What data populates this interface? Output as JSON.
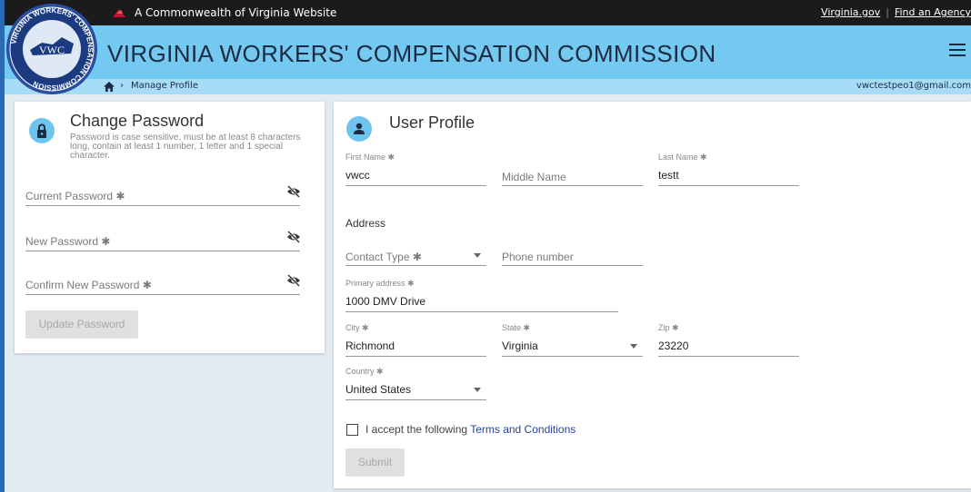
{
  "header": {
    "commonwealth_text": "A Commonwealth of Virginia Website",
    "links": [
      "Virginia.gov",
      "Find an Agency"
    ],
    "title": "VIRGINIA WORKERS' COMPENSATION COMMISSION",
    "logo_ring_text": "VIRGINIA WORKERS' COMPENSATION COMMISSION",
    "logo_center": "VWC"
  },
  "breadcrumb": {
    "current": "Manage Profile",
    "user_email": "vwctestpeo1@gmail.com"
  },
  "change_password": {
    "title": "Change Password",
    "help": "Password is case sensitive, must be at least 8 characters long, contain at least 1 number, 1 letter and 1 special character.",
    "current_label": "Current Password ✱",
    "new_label": "New Password ✱",
    "confirm_label": "Confirm New Password ✱",
    "button": "Update Password"
  },
  "user_profile": {
    "title": "User Profile",
    "first_name_label": "First Name ✱",
    "first_name_value": "vwcc",
    "middle_name_placeholder": "Middle Name",
    "last_name_label": "Last Name ✱",
    "last_name_value": "testt",
    "address_heading": "Address",
    "contact_type_label": "Contact Type ✱",
    "phone_placeholder": "Phone number",
    "primary_address_label": "Primary address ✱",
    "primary_address_value": "1000 DMV Drive",
    "city_label": "City ✱",
    "city_value": "Richmond",
    "state_label": "State ✱",
    "state_value": "Virginia",
    "zip_label": "Zip ✱",
    "zip_value": "23220",
    "country_label": "Country ✱",
    "country_value": "United States",
    "accept_text": "I accept the following",
    "terms_link": "Terms and Conditions",
    "submit": "Submit"
  },
  "colors": {
    "banner": "#73c9ef",
    "breadcrumb_bar": "#a6dcf5",
    "topbar": "#1b1b1b",
    "background": "#e4eaf1",
    "link": "#2a3fa0"
  }
}
